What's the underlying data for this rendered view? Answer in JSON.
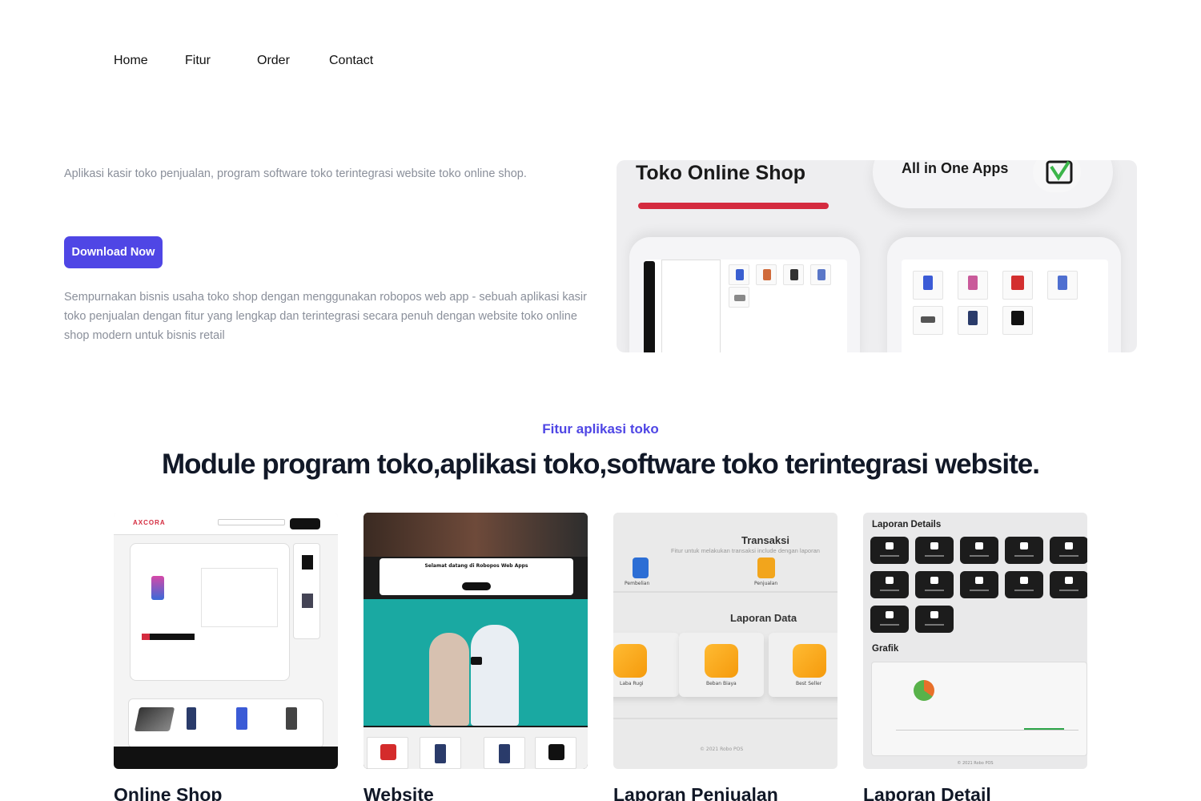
{
  "nav": {
    "items": [
      "Home",
      "Fitur",
      "Order",
      "Contact"
    ]
  },
  "hero": {
    "tagline": "Aplikasi kasir toko penjualan, program software toko terintegrasi website toko online shop.",
    "cta_label": "Download Now",
    "description": "Sempurnakan bisnis usaha toko shop dengan menggunakan robopos web app - sebuah aplikasi kasir toko penjualan dengan fitur yang lengkap dan terintegrasi secara penuh dengan website toko online shop modern untuk bisnis retail",
    "image": {
      "title": "Toko Online Shop",
      "badge": "All in One Apps"
    }
  },
  "features": {
    "eyebrow": "Fitur aplikasi toko",
    "headline": "Module program toko,aplikasi toko,software toko terintegrasi website.",
    "cards": [
      {
        "title": "Online Shop",
        "thumb": {
          "logo": "AXCORA"
        }
      },
      {
        "title": "Website",
        "thumb": {
          "welcome": "Selamat datang di Robopos Web Apps"
        }
      },
      {
        "title": "Laporan Penjualan",
        "thumb": {
          "transaksi": "Transaksi",
          "transaksi_sub": "Fitur untuk melakukan transaksi include dengan laporan",
          "pembelian": "Pembelian",
          "penjualan": "Penjualan",
          "laporan_data": "Laporan Data",
          "tiles": [
            "Laba Rugi",
            "Beban Biaya",
            "Best Seller"
          ],
          "copyright": "© 2021 Robo POS"
        }
      },
      {
        "title": "Laporan Detail",
        "thumb": {
          "heading": "Laporan Details",
          "icons": [
            "Stok",
            "Best Seller",
            "Minim Stok",
            "Expired Stok",
            "Produk",
            "Monthly",
            "Penjualan",
            "Pembayaran",
            "Laba Rugi",
            "Pembelian",
            "Supplier",
            "Staff"
          ],
          "grafik": "Grafik",
          "copyright": "© 2021 Robo POS"
        }
      }
    ]
  },
  "colors": {
    "accent": "#4f46e5",
    "brand_red": "#d42b3f",
    "muted_text": "#8a8f9a",
    "heading": "#111827"
  }
}
